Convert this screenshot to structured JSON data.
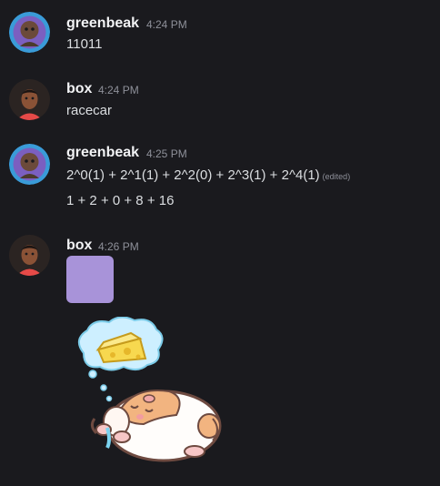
{
  "colors": {
    "background": "#1a1a1e",
    "swatch": "#a893d9"
  },
  "messages": [
    {
      "author": "greenbeak",
      "time": "4:24 PM",
      "lines": [
        "11011"
      ]
    },
    {
      "author": "box",
      "time": "4:24 PM",
      "lines": [
        "racecar"
      ]
    },
    {
      "author": "greenbeak",
      "time": "4:25 PM",
      "lines": [
        "2^0(1) + 2^1(1) + 2^2(0) + 2^3(1) + 2^4(1)",
        "1 + 2 + 0 + 8 + 16"
      ],
      "edited_label": "(edited)"
    },
    {
      "author": "box",
      "time": "4:26 PM",
      "attachments": [
        "color-swatch",
        "hamster-sticker"
      ]
    }
  ],
  "icons": {
    "greenbeak_avatar": "greenbeak-avatar-icon",
    "box_avatar": "box-avatar-icon",
    "sticker": "sleeping-hamster-dreaming-of-cheese-sticker"
  }
}
